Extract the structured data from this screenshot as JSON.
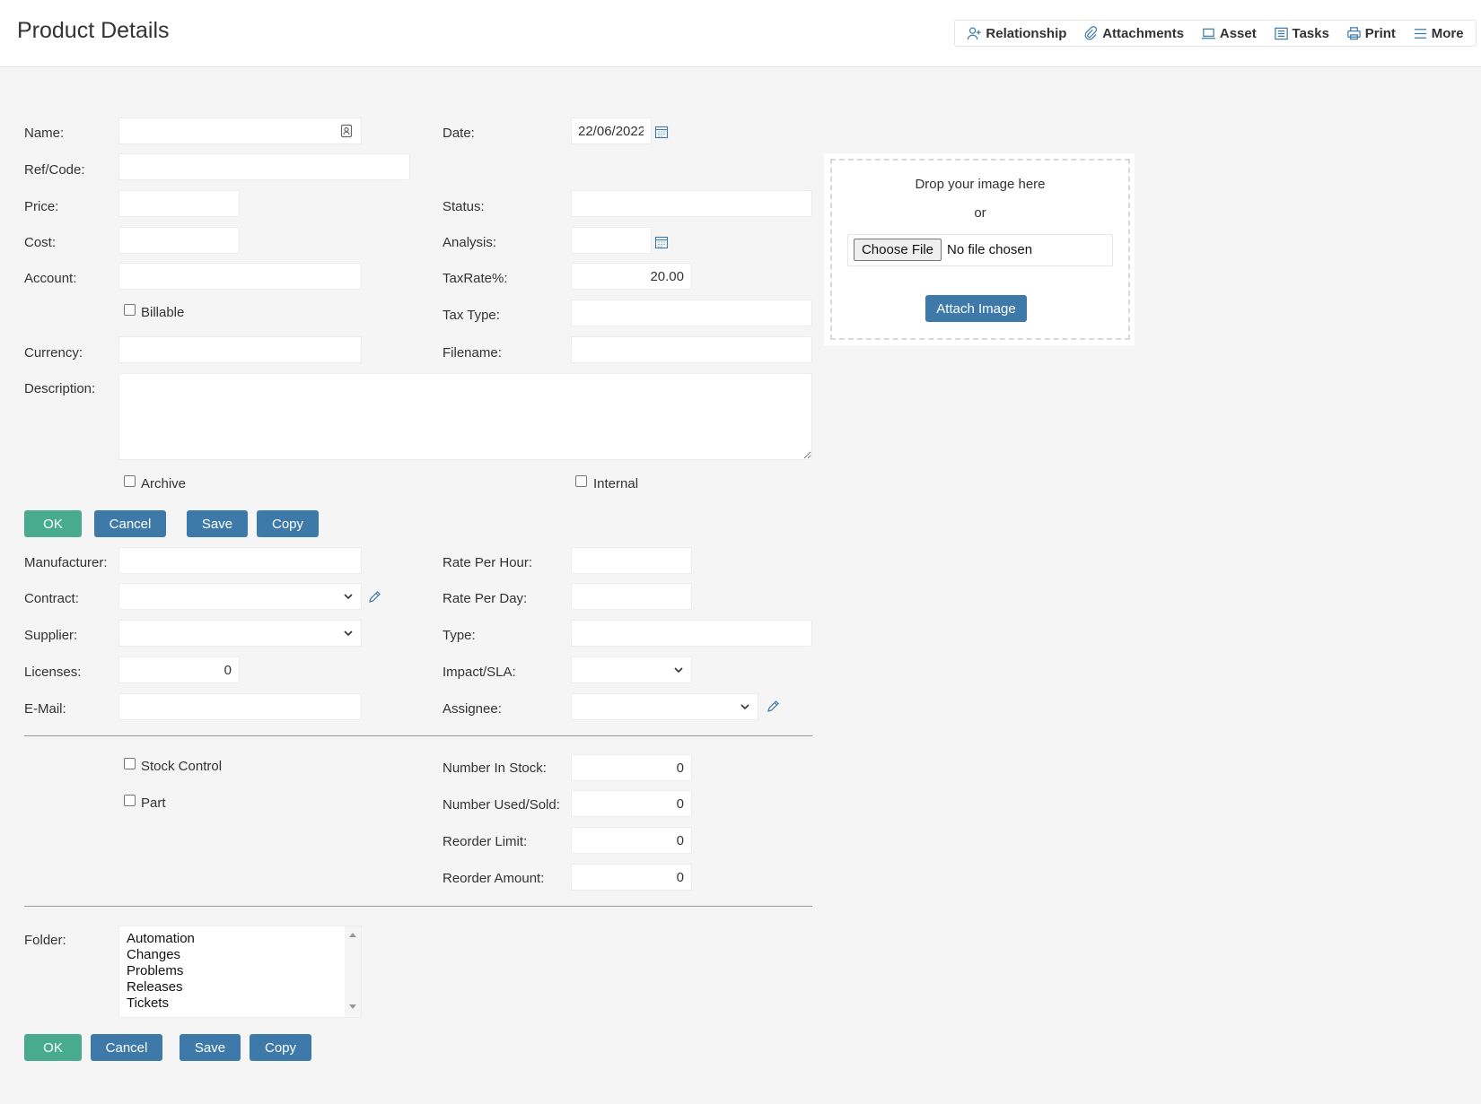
{
  "header": {
    "title": "Product Details",
    "toolbar": [
      {
        "label": "Relationship",
        "icon": "user-plus-icon"
      },
      {
        "label": "Attachments",
        "icon": "paperclip-icon"
      },
      {
        "label": "Asset",
        "icon": "laptop-icon"
      },
      {
        "label": "Tasks",
        "icon": "list-icon"
      },
      {
        "label": "Print",
        "icon": "printer-icon"
      },
      {
        "label": "More",
        "icon": "menu-icon"
      }
    ]
  },
  "form": {
    "name": {
      "label": "Name:",
      "value": ""
    },
    "date": {
      "label": "Date:",
      "value": "22/06/2022"
    },
    "ref_code": {
      "label": "Ref/Code:",
      "value": ""
    },
    "price": {
      "label": "Price:",
      "value": ""
    },
    "status": {
      "label": "Status:",
      "value": ""
    },
    "cost": {
      "label": "Cost:",
      "value": ""
    },
    "analysis": {
      "label": "Analysis:",
      "value": ""
    },
    "account": {
      "label": "Account:",
      "value": ""
    },
    "tax_rate": {
      "label": "TaxRate%:",
      "value": "20.00"
    },
    "billable": {
      "label": "Billable",
      "checked": false
    },
    "tax_type": {
      "label": "Tax Type:",
      "value": ""
    },
    "currency": {
      "label": "Currency:",
      "value": ""
    },
    "filename": {
      "label": "Filename:",
      "value": ""
    },
    "description": {
      "label": "Description:",
      "value": ""
    },
    "archive": {
      "label": "Archive",
      "checked": false
    },
    "internal": {
      "label": "Internal",
      "checked": false
    }
  },
  "image_upload": {
    "drop_text": "Drop your image here",
    "or_text": "or",
    "choose_file": "Choose File",
    "no_file": "No file chosen",
    "attach_label": "Attach Image"
  },
  "buttons": {
    "ok": "OK",
    "cancel": "Cancel",
    "save": "Save",
    "copy": "Copy"
  },
  "details": {
    "manufacturer": {
      "label": "Manufacturer:",
      "value": ""
    },
    "rate_per_hour": {
      "label": "Rate Per Hour:",
      "value": ""
    },
    "contract": {
      "label": "Contract:",
      "value": ""
    },
    "rate_per_day": {
      "label": "Rate Per Day:",
      "value": ""
    },
    "supplier": {
      "label": "Supplier:",
      "value": ""
    },
    "type": {
      "label": "Type:",
      "value": ""
    },
    "licenses": {
      "label": "Licenses:",
      "value": "0"
    },
    "impact_sla": {
      "label": "Impact/SLA:",
      "value": ""
    },
    "email": {
      "label": "E-Mail:",
      "value": ""
    },
    "assignee": {
      "label": "Assignee:",
      "value": ""
    }
  },
  "stock": {
    "stock_control": {
      "label": "Stock Control",
      "checked": false
    },
    "part": {
      "label": "Part",
      "checked": false
    },
    "number_in_stock": {
      "label": "Number In Stock:",
      "value": "0"
    },
    "number_used_sold": {
      "label": "Number Used/Sold:",
      "value": "0"
    },
    "reorder_limit": {
      "label": "Reorder Limit:",
      "value": "0"
    },
    "reorder_amount": {
      "label": "Reorder Amount:",
      "value": "0"
    }
  },
  "folder": {
    "label": "Folder:",
    "options": [
      "Automation",
      "Changes",
      "Problems",
      "Releases",
      "Tickets"
    ]
  },
  "colors": {
    "ok_button": "#48ab8e",
    "action_button": "#3d7aa9",
    "icon_blue": "#3d7aa9"
  }
}
